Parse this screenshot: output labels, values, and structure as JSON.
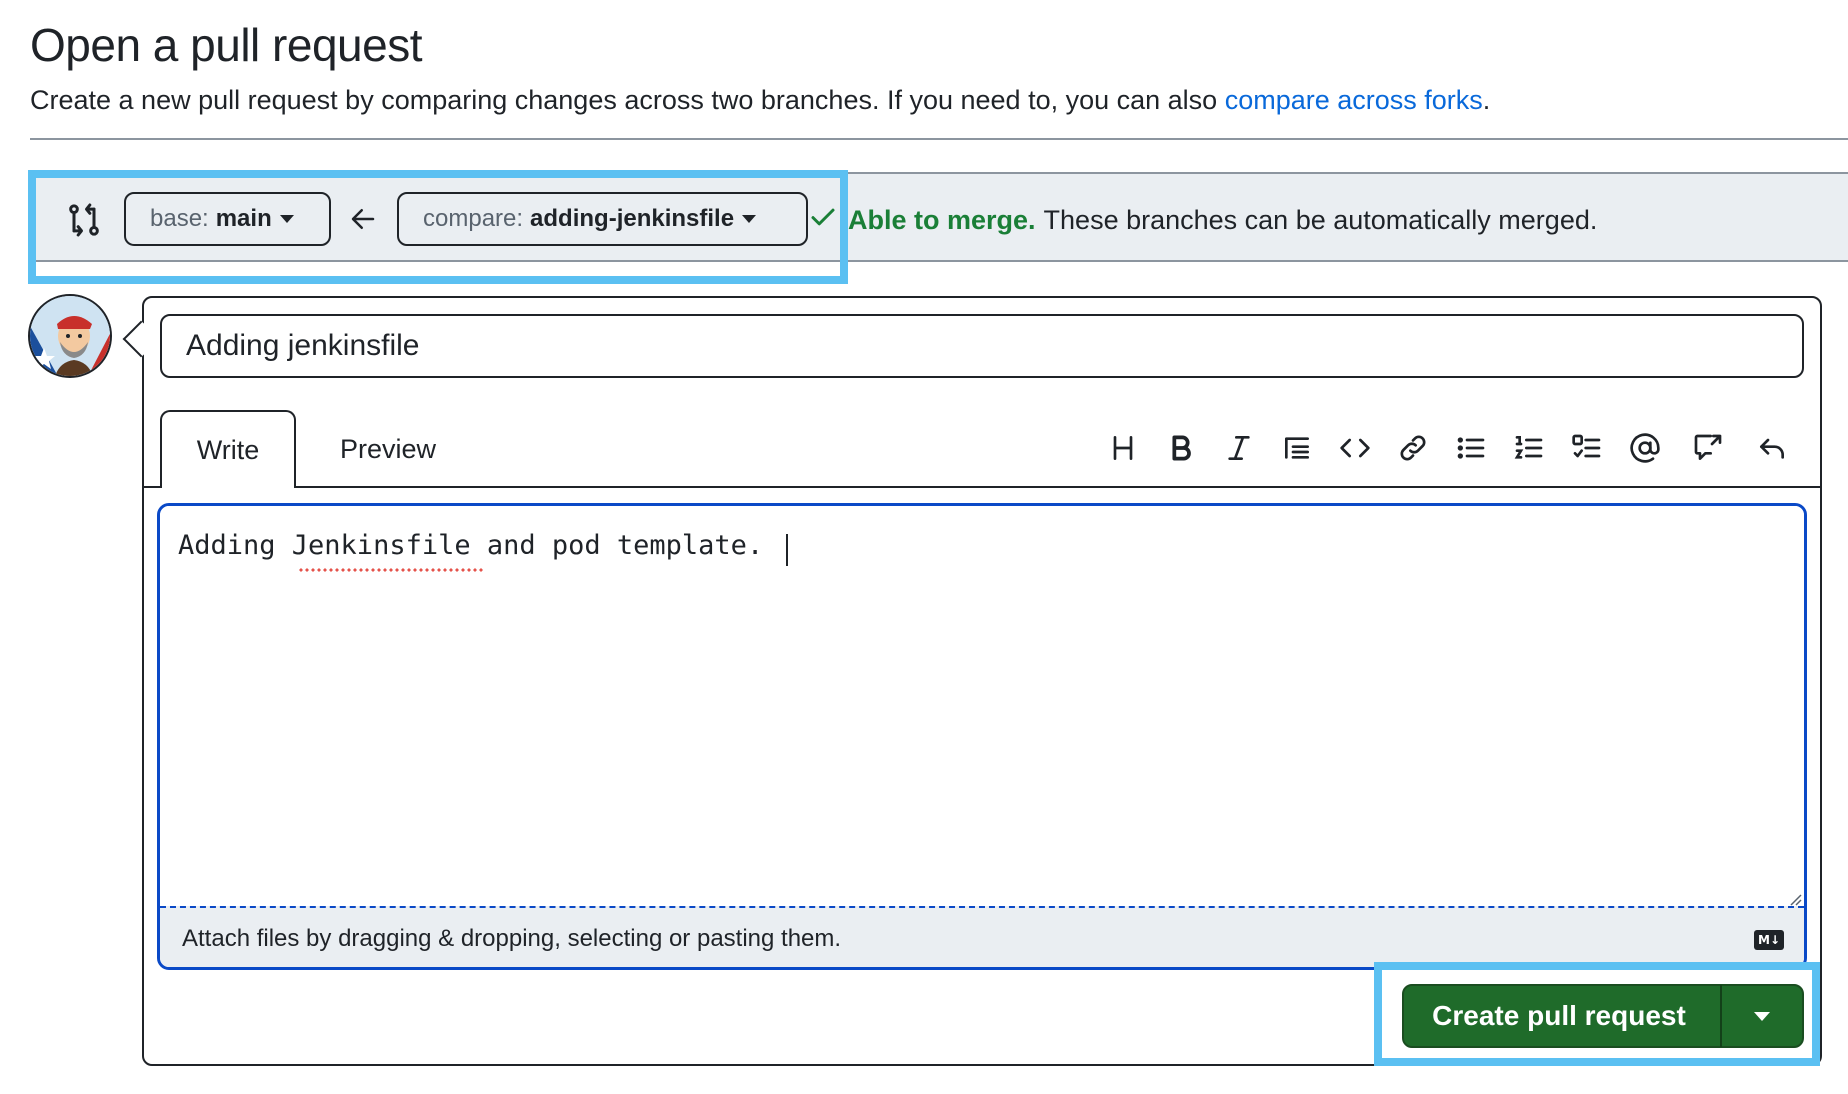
{
  "header": {
    "title": "Open a pull request",
    "subtitle": "Create a new pull request by comparing changes across two branches. If you need to, you can also ",
    "subtitle_link": "compare across forks",
    "subtitle_end": "."
  },
  "range": {
    "base_prefix": "base:",
    "base_value": "main",
    "compare_prefix": "compare:",
    "compare_value": "adding-jenkinsfile",
    "merge_status": "Able to merge.",
    "merge_detail": "These branches can be automatically merged."
  },
  "form": {
    "title_value": "Adding jenkinsfile",
    "tabs": [
      {
        "label": "Write",
        "active": true
      },
      {
        "label": "Preview",
        "active": false
      }
    ],
    "toolbar_icons": [
      "heading-icon",
      "bold-icon",
      "italic-icon",
      "quote-icon",
      "code-icon",
      "link-icon",
      "unordered-list-icon",
      "ordered-list-icon",
      "task-list-icon",
      "mention-icon",
      "cross-reference-icon",
      "undo-icon"
    ],
    "body_value": "Adding Jenkinsfile and pod template.",
    "attach_text": "Attach files by dragging & dropping, selecting or pasting them.",
    "markdown_badge": "M↓",
    "submit_label": "Create pull request"
  },
  "colors": {
    "accent_link": "#0969da",
    "merge_green": "#1a7f37",
    "button_green": "#1f6b2a",
    "highlight": "#5bc0f2",
    "editor_focus": "#0a49c7"
  }
}
